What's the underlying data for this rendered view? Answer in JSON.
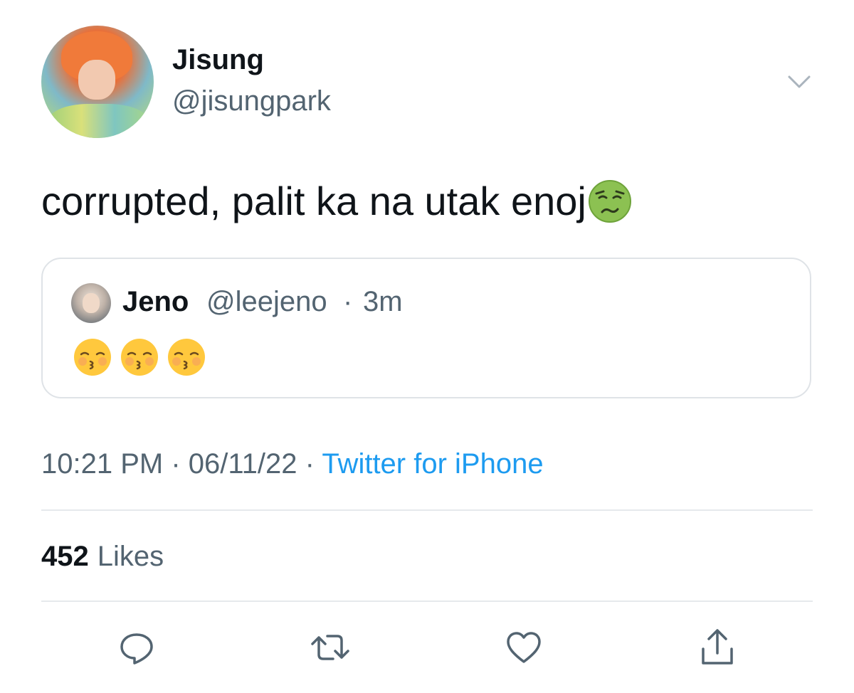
{
  "author": {
    "name": "Jisung",
    "handle": "@jisungpark"
  },
  "tweet": {
    "text": "corrupted, palit ka na utak enoj",
    "trailing_emoji": "nauseated-face-icon"
  },
  "quoted_tweet": {
    "name": "Jeno",
    "handle": "@leejeno",
    "separator": "·",
    "time": "3m",
    "emojis": [
      "kissing-face-closed-eyes-icon",
      "kissing-face-closed-eyes-icon",
      "kissing-face-closed-eyes-icon"
    ]
  },
  "meta": {
    "time": "10:21 PM",
    "separator": " · ",
    "date": "06/11/22",
    "source": "Twitter for iPhone"
  },
  "stats": {
    "likes_count": "452",
    "likes_label": "Likes"
  },
  "actions": [
    "reply-icon",
    "retweet-icon",
    "like-icon",
    "share-icon"
  ],
  "colors": {
    "text": "#0f1419",
    "secondary": "#536471",
    "link": "#1d9bf0",
    "border": "#dfe3e7"
  }
}
